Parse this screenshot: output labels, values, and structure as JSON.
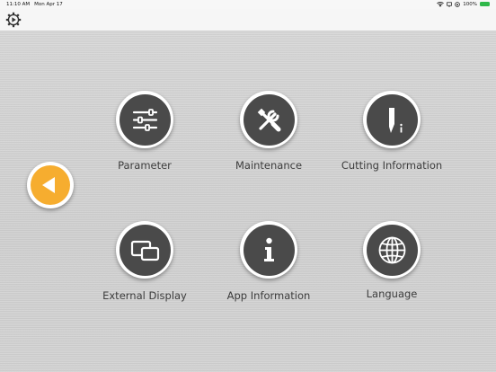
{
  "status_bar": {
    "time": "11:10 AM",
    "date": "Mon Apr 17",
    "battery_percent": "100%",
    "battery_color": "#2fb84a"
  },
  "toolbar": {
    "settings_icon": "gear-play-icon"
  },
  "navigation": {
    "back_icon": "chevron-left-icon",
    "accent_color": "#f6ad2f"
  },
  "menu": {
    "parameter": {
      "label": "Parameter",
      "icon": "sliders-icon"
    },
    "maintenance": {
      "label": "Maintenance",
      "icon": "tools-icon"
    },
    "cutting_information": {
      "label": "Cutting Information",
      "icon": "blade-info-icon"
    },
    "external_display": {
      "label": "External Display",
      "icon": "screens-icon"
    },
    "app_information": {
      "label": "App Information",
      "icon": "info-icon"
    },
    "language": {
      "label": "Language",
      "icon": "globe-icon"
    }
  }
}
